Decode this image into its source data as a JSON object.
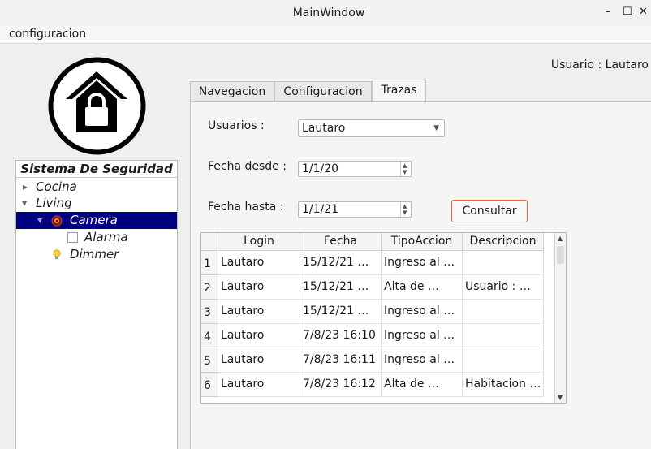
{
  "window": {
    "title": "MainWindow",
    "minimize_glyph": "–",
    "maximize_glyph": "☐",
    "close_glyph": "✕"
  },
  "menu": {
    "items": [
      "configuracion"
    ]
  },
  "user_label": "Usuario : Lautaro",
  "logo": {
    "icon": "house-lock-icon"
  },
  "tree": {
    "header": "Sistema De Seguridad",
    "nodes": [
      {
        "label": "Cocina",
        "expanded": false
      },
      {
        "label": "Living",
        "expanded": true
      },
      {
        "label": "Camera",
        "icon": "camera-icon",
        "selected": true
      },
      {
        "label": "Alarma",
        "icon": "checkbox-icon",
        "checked": false
      },
      {
        "label": "Dimmer",
        "icon": "bulb-icon"
      }
    ]
  },
  "tabs": [
    "Navegacion",
    "Configuracion",
    "Trazas"
  ],
  "active_tab": "Trazas",
  "form": {
    "usuarios_label": "Usuarios :",
    "usuarios_value": "Lautaro",
    "fecha_desde_label": "Fecha desde :",
    "fecha_desde_value": "1/1/20",
    "fecha_hasta_label": "Fecha hasta :",
    "fecha_hasta_value": "1/1/21",
    "consultar_label": "Consultar"
  },
  "table": {
    "columns": [
      "Login",
      "Fecha",
      "TipoAccion",
      "Descripcion"
    ],
    "rows": [
      {
        "n": "1",
        "login": "Lautaro",
        "fecha": "15/12/21 …",
        "tipo": "Ingreso al …",
        "desc": ""
      },
      {
        "n": "2",
        "login": "Lautaro",
        "fecha": "15/12/21 …",
        "tipo": "Alta de …",
        "desc": "Usuario : …"
      },
      {
        "n": "3",
        "login": "Lautaro",
        "fecha": "15/12/21 …",
        "tipo": "Ingreso al …",
        "desc": ""
      },
      {
        "n": "4",
        "login": "Lautaro",
        "fecha": "7/8/23 16:10",
        "tipo": "Ingreso al …",
        "desc": ""
      },
      {
        "n": "5",
        "login": "Lautaro",
        "fecha": "7/8/23 16:11",
        "tipo": "Ingreso al …",
        "desc": ""
      },
      {
        "n": "6",
        "login": "Lautaro",
        "fecha": "7/8/23 16:12",
        "tipo": "Alta de …",
        "desc": "Habitacion …"
      }
    ]
  },
  "colors": {
    "selection": "#000080",
    "button_border": "#e8603c"
  }
}
